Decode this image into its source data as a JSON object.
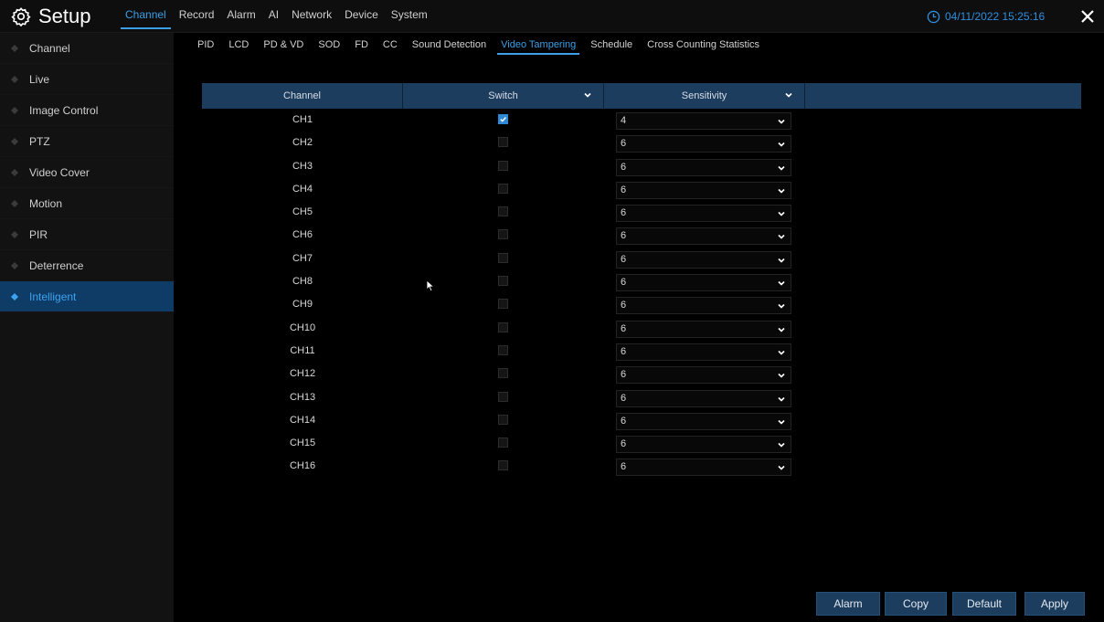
{
  "header": {
    "title": "Setup",
    "nav": [
      "Channel",
      "Record",
      "Alarm",
      "AI",
      "Network",
      "Device",
      "System"
    ],
    "active_nav": 0,
    "datetime": "04/11/2022 15:25:16",
    "accent_color": "#3d9fe6"
  },
  "sidebar": {
    "items": [
      {
        "label": "Channel"
      },
      {
        "label": "Live"
      },
      {
        "label": "Image Control"
      },
      {
        "label": "PTZ"
      },
      {
        "label": "Video Cover"
      },
      {
        "label": "Motion"
      },
      {
        "label": "PIR"
      },
      {
        "label": "Deterrence"
      },
      {
        "label": "Intelligent"
      }
    ],
    "active_index": 8
  },
  "subtabs": {
    "items": [
      "PID",
      "LCD",
      "PD & VD",
      "SOD",
      "FD",
      "CC",
      "Sound Detection",
      "Video Tampering",
      "Schedule",
      "Cross Counting Statistics"
    ],
    "active_index": 7
  },
  "table": {
    "headers": {
      "channel": "Channel",
      "switch": "Switch",
      "sensitivity": "Sensitivity"
    },
    "rows": [
      {
        "channel": "CH1",
        "enabled": true,
        "sensitivity": "4"
      },
      {
        "channel": "CH2",
        "enabled": false,
        "sensitivity": "6"
      },
      {
        "channel": "CH3",
        "enabled": false,
        "sensitivity": "6"
      },
      {
        "channel": "CH4",
        "enabled": false,
        "sensitivity": "6"
      },
      {
        "channel": "CH5",
        "enabled": false,
        "sensitivity": "6"
      },
      {
        "channel": "CH6",
        "enabled": false,
        "sensitivity": "6"
      },
      {
        "channel": "CH7",
        "enabled": false,
        "sensitivity": "6"
      },
      {
        "channel": "CH8",
        "enabled": false,
        "sensitivity": "6"
      },
      {
        "channel": "CH9",
        "enabled": false,
        "sensitivity": "6"
      },
      {
        "channel": "CH10",
        "enabled": false,
        "sensitivity": "6"
      },
      {
        "channel": "CH11",
        "enabled": false,
        "sensitivity": "6"
      },
      {
        "channel": "CH12",
        "enabled": false,
        "sensitivity": "6"
      },
      {
        "channel": "CH13",
        "enabled": false,
        "sensitivity": "6"
      },
      {
        "channel": "CH14",
        "enabled": false,
        "sensitivity": "6"
      },
      {
        "channel": "CH15",
        "enabled": false,
        "sensitivity": "6"
      },
      {
        "channel": "CH16",
        "enabled": false,
        "sensitivity": "6"
      }
    ]
  },
  "buttons": {
    "alarm": "Alarm",
    "copy": "Copy",
    "default": "Default",
    "apply": "Apply"
  }
}
